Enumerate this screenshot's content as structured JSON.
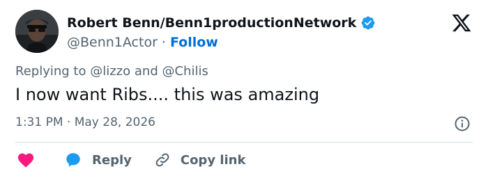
{
  "author": {
    "display_name": "Robert Benn/Benn1productionNetwork",
    "handle": "@Benn1Actor",
    "separator": "·",
    "follow_label": "Follow",
    "verified": true
  },
  "brand": {
    "logo": "x-logo-icon"
  },
  "reply_context": {
    "prefix": "Replying to",
    "mention_1": "@lizzo",
    "conjunction": "and",
    "mention_2": "@Chilis"
  },
  "tweet": {
    "text": "I now want Ribs.... this was amazing"
  },
  "meta": {
    "time": "1:31 PM",
    "separator": "·",
    "date": "May 28, 2026"
  },
  "actions": {
    "like_icon": "heart-icon",
    "reply_label": "Reply",
    "copy_link_label": "Copy link"
  },
  "colors": {
    "accent": "#1d9bf0",
    "follow": "#006fd6",
    "like": "#f91880",
    "muted": "#536471",
    "text": "#0f1419",
    "divider": "#cfd9de"
  }
}
